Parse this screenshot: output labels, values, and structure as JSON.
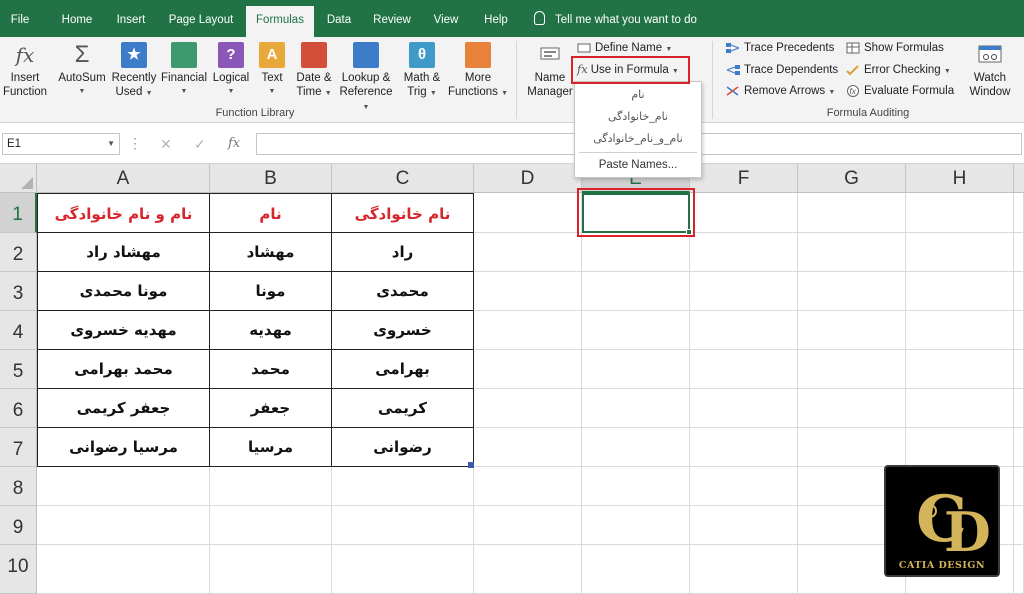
{
  "ribbon_tabs": [
    "File",
    "Home",
    "Insert",
    "Page Layout",
    "Formulas",
    "Data",
    "Review",
    "View",
    "Help"
  ],
  "tell_me": "Tell me what you want to do",
  "function_library": {
    "insert_function": [
      "Insert",
      "Function"
    ],
    "autosum": "AutoSum",
    "recently_used": [
      "Recently",
      "Used"
    ],
    "financial": "Financial",
    "logical": "Logical",
    "text": "Text",
    "date_time": [
      "Date &",
      "Time"
    ],
    "lookup_reference": [
      "Lookup &",
      "Reference"
    ],
    "math_trig": [
      "Math &",
      "Trig"
    ],
    "more_functions": [
      "More",
      "Functions"
    ],
    "group_label": "Function Library",
    "icon_fx": "fx",
    "icon_sigma": "Σ",
    "icon_star": "★",
    "icon_question": "?",
    "icon_a": "A",
    "icon_theta": "θ"
  },
  "defined_names": {
    "name_manager": [
      "Name",
      "Manager"
    ],
    "define_name": "Define Name",
    "use_in_formula": "Use in Formula",
    "icon_fx": "fx"
  },
  "formula_auditing": {
    "trace_precedents": "Trace Precedents",
    "trace_dependents": "Trace Dependents",
    "remove_arrows": "Remove Arrows",
    "show_formulas": "Show Formulas",
    "error_checking": "Error Checking",
    "evaluate_formula": "Evaluate Formula",
    "watch_window": [
      "Watch",
      "Window"
    ],
    "group_label": "Formula Auditing"
  },
  "formula_bar": {
    "name_box": "E1",
    "cancel_symbol": "✕",
    "enter_symbol": "✓",
    "fx_symbol": "fx",
    "content": ""
  },
  "dropdown": {
    "items": [
      "نام",
      "نام_خانوادگی",
      "نام_و_نام_خانوادگی"
    ],
    "paste_names": "Paste Names..."
  },
  "columns": [
    "A",
    "B",
    "C",
    "D",
    "E",
    "F",
    "G",
    "H"
  ],
  "rows": [
    "1",
    "2",
    "3",
    "4",
    "5",
    "6",
    "7",
    "8",
    "9",
    "10"
  ],
  "table": {
    "headers": [
      "نام و نام خانوادگی",
      "نام",
      "نام خانوادگی"
    ],
    "rows": [
      [
        "مهشاد راد",
        "مهشاد",
        "راد"
      ],
      [
        "مونا محمدی",
        "مونا",
        "محمدی"
      ],
      [
        "مهدیه خسروی",
        "مهدیه",
        "خسروی"
      ],
      [
        "محمد بهرامی",
        "محمد",
        "بهرامی"
      ],
      [
        "جعفر کریمی",
        "جعفر",
        "کریمی"
      ],
      [
        "مرسیا رضوانی",
        "مرسیا",
        "رضوانی"
      ]
    ]
  },
  "logo": {
    "text": "CATIA DESIGN",
    "monogram": "CD"
  },
  "colors": {
    "excel_green": "#217346",
    "header_red": "#d6262b",
    "highlight_red": "#d9232b",
    "logo_gold": "#d4b45a"
  }
}
